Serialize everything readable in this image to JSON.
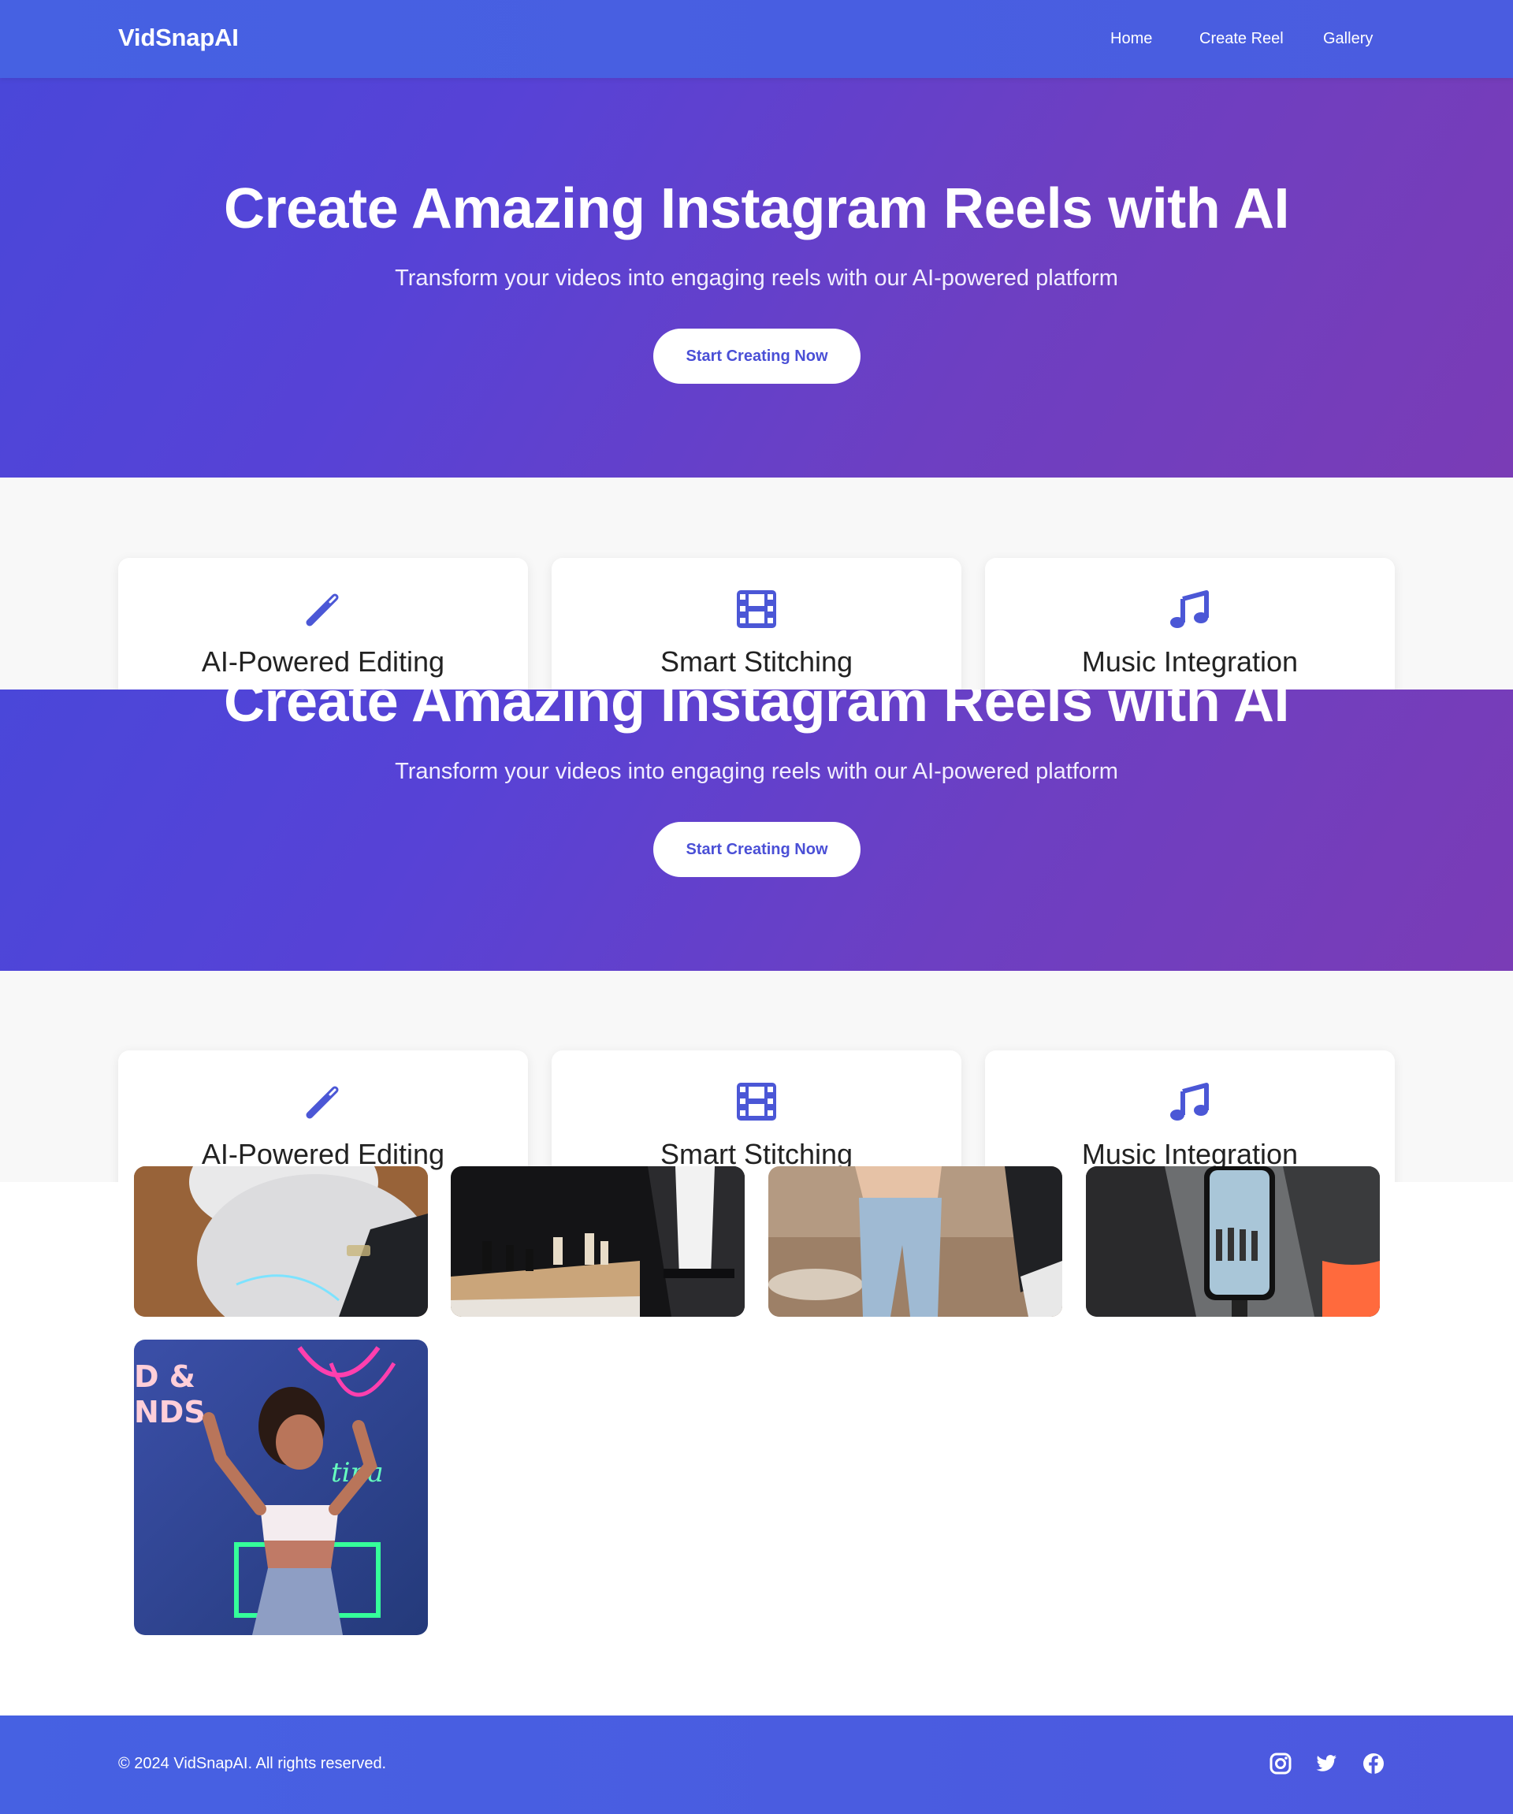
{
  "nav": {
    "brand": "VidSnapAI",
    "links": [
      "Home",
      "Create Reel",
      "Gallery"
    ]
  },
  "hero": {
    "title": "Create Amazing Instagram Reels with AI",
    "subtitle": "Transform your videos into engaging reels with our AI-powered platform",
    "cta": "Start Creating Now"
  },
  "features": [
    {
      "icon": "magic-wand-icon",
      "title": "AI-Powered Editing"
    },
    {
      "icon": "film-icon",
      "title": "Smart Stitching"
    },
    {
      "icon": "music-note-icon",
      "title": "Music Integration"
    }
  ],
  "gallery": {
    "items": [
      "robot-photo",
      "chess-photo",
      "jeans-photo",
      "phone-recording-photo",
      "neon-dancer-photo"
    ]
  },
  "footer": {
    "copyright": "© 2024 VidSnapAI. All rights reserved.",
    "social": [
      "instagram-icon",
      "twitter-icon",
      "facebook-icon"
    ]
  },
  "colors": {
    "nav": "#4661e2",
    "accent": "#4a4fd6",
    "hero_start": "#4a47d9",
    "hero_end": "#7a3cb6"
  }
}
